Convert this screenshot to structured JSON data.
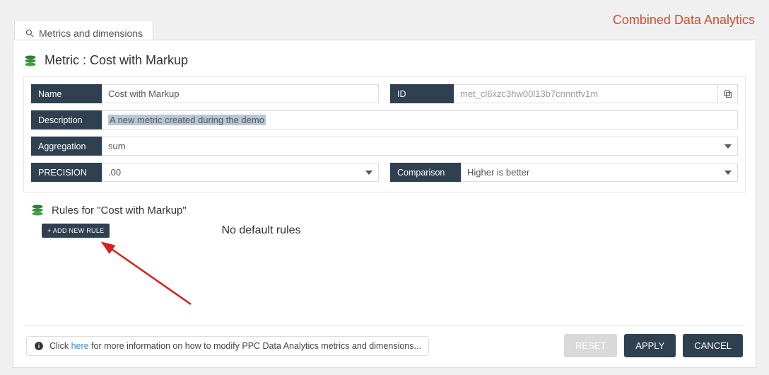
{
  "brand": "Combined Data Analytics",
  "tab": {
    "label": "Metrics and dimensions"
  },
  "metric": {
    "title_prefix": "Metric : ",
    "title_value": "Cost with Markup",
    "labels": {
      "name": "Name",
      "id": "ID",
      "description": "Description",
      "aggregation": "Aggregation",
      "precision": "PRECISION",
      "comparison": "Comparison"
    },
    "values": {
      "name": "Cost with Markup",
      "id": "met_cl6xzc3hw00l13b7cnnntfv1m",
      "description": "A new metric created during the demo",
      "aggregation": "sum",
      "precision": ".00",
      "comparison": "Higher is better"
    }
  },
  "rules": {
    "title_prefix": "Rules for \"",
    "title_value": "Cost with Markup",
    "title_suffix": "\"",
    "add_label": "+ ADD NEW RULE",
    "empty": "No default rules"
  },
  "footer": {
    "info_pre": "Click ",
    "info_link": "here",
    "info_post": " for more information on how to modify PPC Data Analytics metrics and dimensions...",
    "reset": "RESET",
    "apply": "APPLY",
    "cancel": "CANCEL"
  }
}
